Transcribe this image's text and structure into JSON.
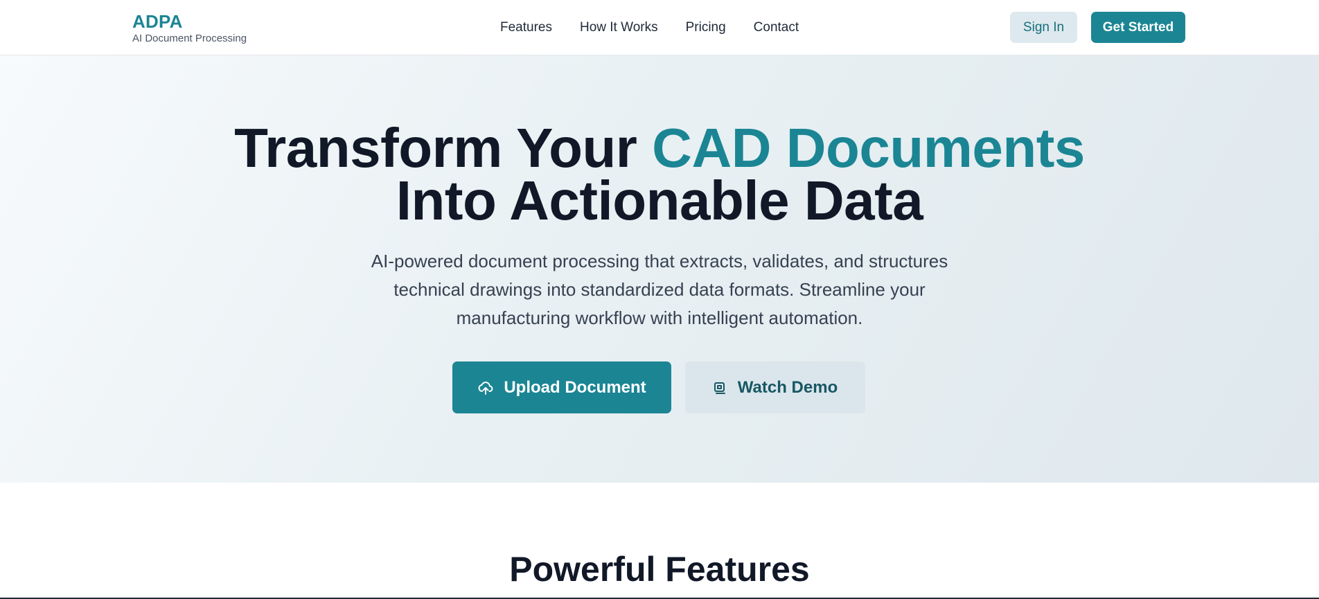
{
  "header": {
    "logo_title": "ADPA",
    "logo_subtitle": "AI Document Processing",
    "nav": [
      {
        "label": "Features"
      },
      {
        "label": "How It Works"
      },
      {
        "label": "Pricing"
      },
      {
        "label": "Contact"
      }
    ],
    "sign_in_label": "Sign In",
    "get_started_label": "Get Started"
  },
  "hero": {
    "title_part1": "Transform Your ",
    "title_accent": "CAD Documents",
    "title_line2": "Into Actionable Data",
    "description": "AI-powered document processing that extracts, validates, and structures technical drawings into standardized data formats. Streamline your manufacturing workflow with intelligent automation.",
    "upload_label": "Upload Document",
    "upload_icon": "cloud-upload-icon",
    "demo_label": "Watch Demo",
    "demo_icon": "video-icon"
  },
  "features": {
    "title": "Powerful Features"
  },
  "colors": {
    "brand": "#1b8594",
    "text_dark": "#111827",
    "hero_bg": "#e8f0f3",
    "secondary_button_bg": "#dbe6ec"
  }
}
